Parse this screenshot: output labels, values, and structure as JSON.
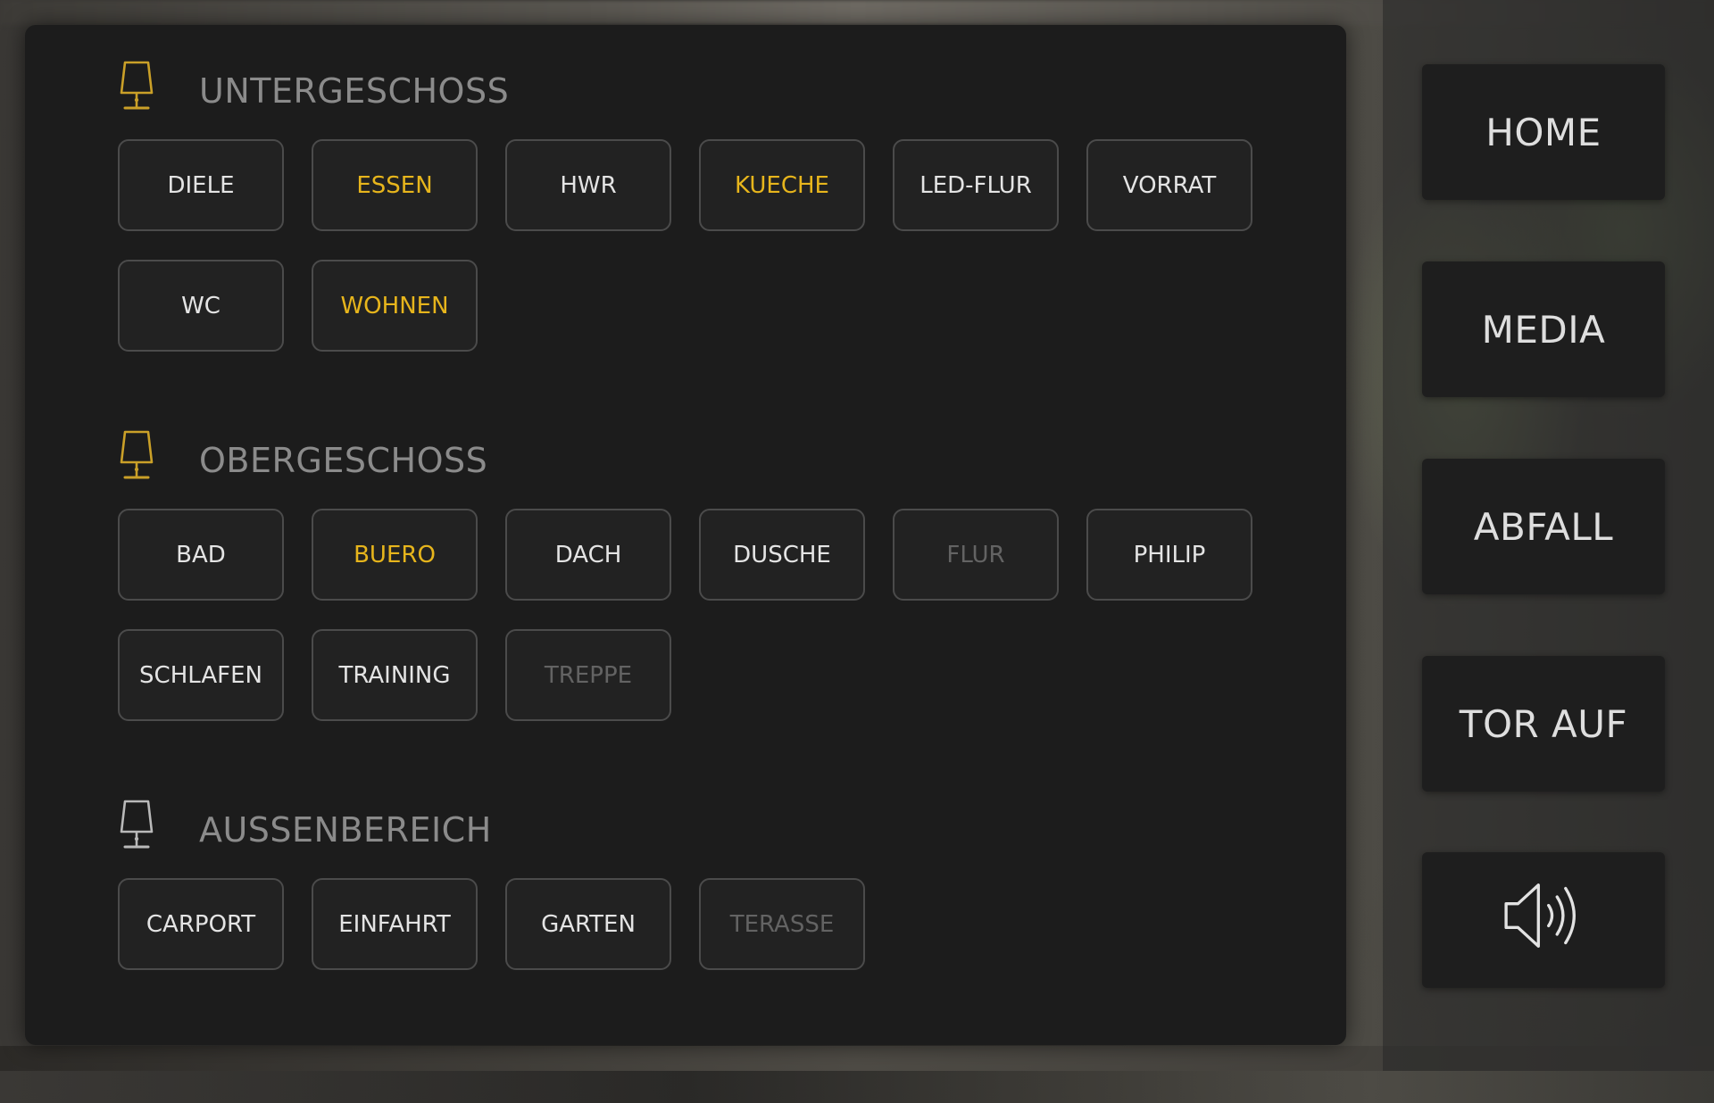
{
  "sections": [
    {
      "title": "UNTERGESCHOSS",
      "icon": "table-lamp-icon",
      "icon_color": "#caa028",
      "rooms": [
        {
          "label": "DIELE",
          "state": "default"
        },
        {
          "label": "ESSEN",
          "state": "on"
        },
        {
          "label": "HWR",
          "state": "default"
        },
        {
          "label": "KUECHE",
          "state": "on"
        },
        {
          "label": "LED-FLUR",
          "state": "default"
        },
        {
          "label": "VORRAT",
          "state": "default"
        },
        {
          "label": "WC",
          "state": "default"
        },
        {
          "label": "WOHNEN",
          "state": "on"
        }
      ]
    },
    {
      "title": "OBERGESCHOSS",
      "icon": "table-lamp-icon",
      "icon_color": "#caa028",
      "rooms": [
        {
          "label": "BAD",
          "state": "default"
        },
        {
          "label": "BUERO",
          "state": "on"
        },
        {
          "label": "DACH",
          "state": "default"
        },
        {
          "label": "DUSCHE",
          "state": "default"
        },
        {
          "label": "FLUR",
          "state": "off"
        },
        {
          "label": "PHILIP",
          "state": "default"
        },
        {
          "label": "SCHLAFEN",
          "state": "default"
        },
        {
          "label": "TRAINING",
          "state": "default"
        },
        {
          "label": "TREPPE",
          "state": "off"
        }
      ]
    },
    {
      "title": "AUSSENBEREICH",
      "icon": "table-lamp-icon",
      "icon_color": "#b9b9b9",
      "rooms": [
        {
          "label": "CARPORT",
          "state": "default"
        },
        {
          "label": "EINFAHRT",
          "state": "default"
        },
        {
          "label": "GARTEN",
          "state": "default"
        },
        {
          "label": "TERASSE",
          "state": "off"
        }
      ]
    }
  ],
  "nav": [
    {
      "label": "HOME",
      "name": "home"
    },
    {
      "label": "MEDIA",
      "name": "media"
    },
    {
      "label": "ABFALL",
      "name": "abfall"
    },
    {
      "label": "TOR AUF",
      "name": "tor-auf"
    },
    {
      "label": "",
      "name": "speaker",
      "icon": "speaker-volume-icon"
    }
  ],
  "colors": {
    "on": "#e7b51c",
    "default": "#e4e4e4",
    "off": "#636363",
    "panel": "#1c1c1c",
    "section_title": "#8b8b8b"
  }
}
